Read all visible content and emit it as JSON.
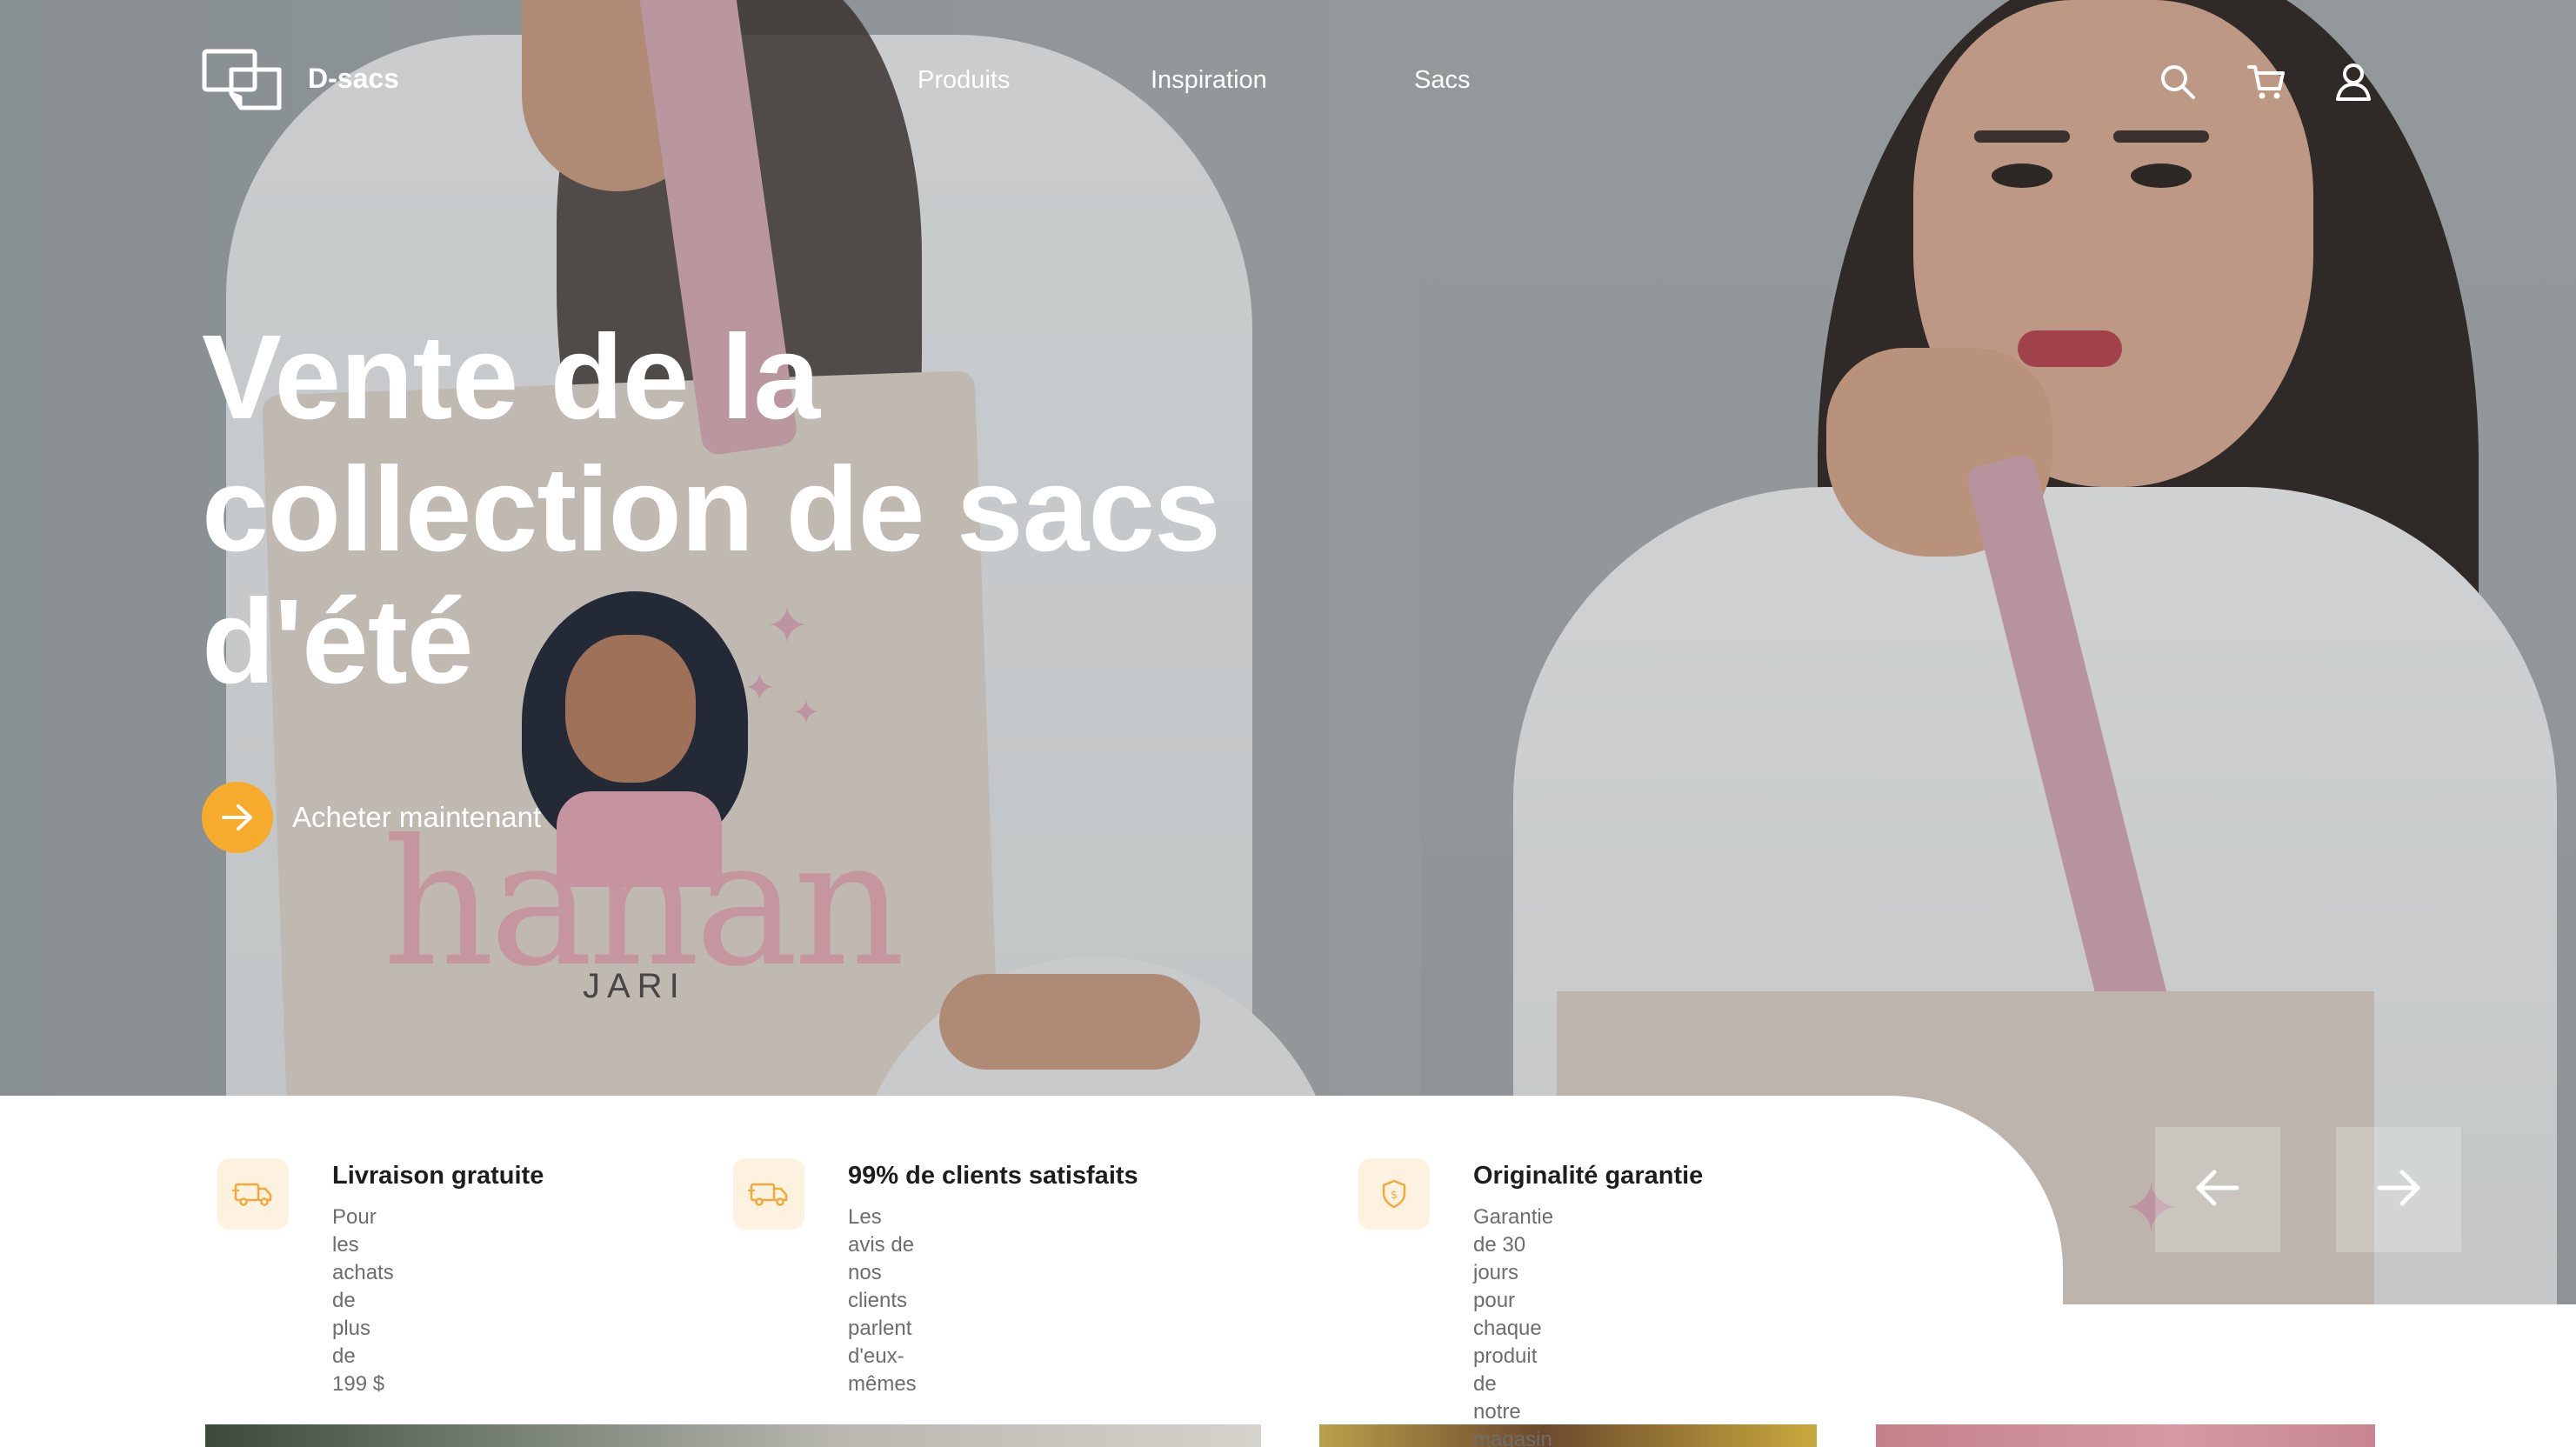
{
  "brand": {
    "name": "D-sacs"
  },
  "nav": {
    "links": [
      "Produits",
      "Inspiration",
      "Sacs"
    ],
    "icons": [
      "search-icon",
      "cart-icon",
      "user-icon"
    ]
  },
  "hero": {
    "headline_lines": [
      "Vente de la",
      "collection de sacs",
      "d'été"
    ],
    "cta_label": "Acheter maintenant",
    "bag_print": {
      "word": "hanan",
      "sub": "JARI"
    }
  },
  "features": [
    {
      "icon": "truck-icon",
      "title": "Livraison gratuite",
      "desc_lines": [
        "Pour les achats de plus",
        "de 199 $"
      ]
    },
    {
      "icon": "truck-icon",
      "title": "99% de clients satisfaits",
      "desc_lines": [
        "Les avis de nos clients parlent",
        "d'eux-mêmes"
      ]
    },
    {
      "icon": "shield-icon",
      "title": "Originalité garantie",
      "desc_lines": [
        "Garantie de 30 jours pour chaque produit de",
        "notre magasin"
      ]
    }
  ],
  "carousel": {
    "prev": "arrow-left-icon",
    "next": "arrow-right-icon"
  },
  "colors": {
    "accent": "#f7ab2c",
    "feature_icon_bg": "#fdf1e0",
    "white": "#ffffff"
  }
}
